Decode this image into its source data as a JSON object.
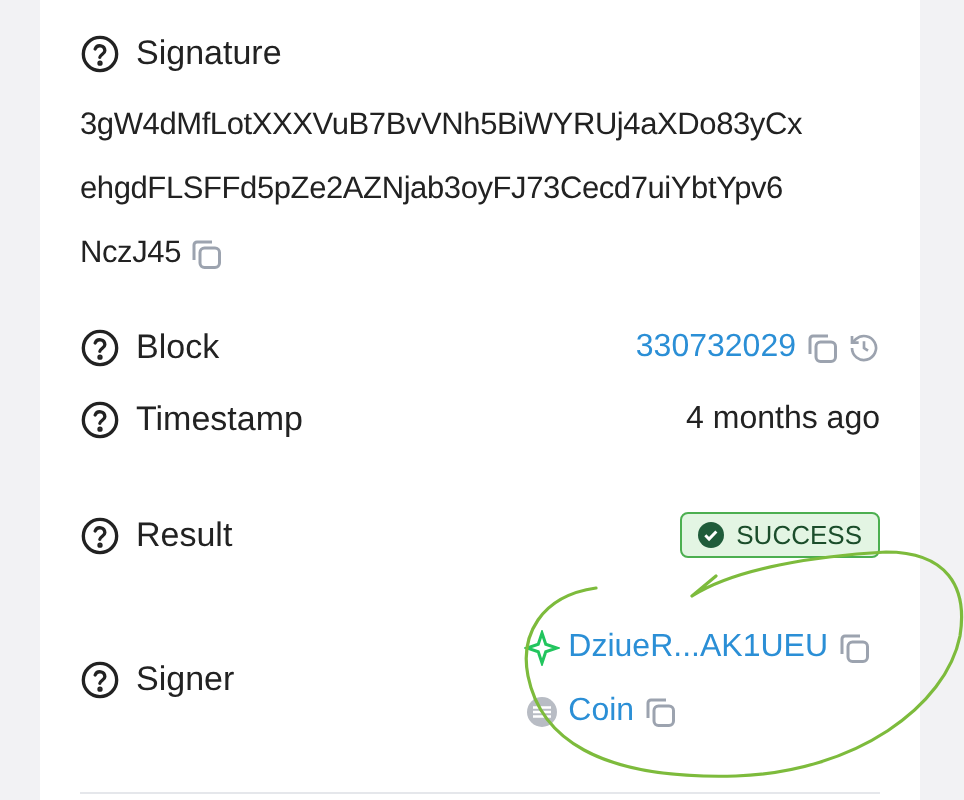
{
  "signature": {
    "label": "Signature",
    "lines": [
      "3gW4dMfLotXXXVuB7BvVNh5BiWYRUj4aXDo83yCx",
      "ehgdFLSFFd5pZe2AZNjab3oyFJ73Cecd7uiYbtYpv6",
      "NczJ45"
    ]
  },
  "fields": [
    {
      "label": "Block",
      "kind": "link",
      "value": "330732029"
    },
    {
      "label": "Timestamp",
      "kind": "text",
      "value": "4 months ago"
    },
    {
      "label": "Result",
      "kind": "badge",
      "value": "SUCCESS"
    }
  ],
  "signer": {
    "label": "Signer",
    "items": [
      {
        "kind": "address",
        "value": "DziueR...AK1UEU"
      },
      {
        "kind": "token",
        "value": "Coin"
      }
    ]
  }
}
